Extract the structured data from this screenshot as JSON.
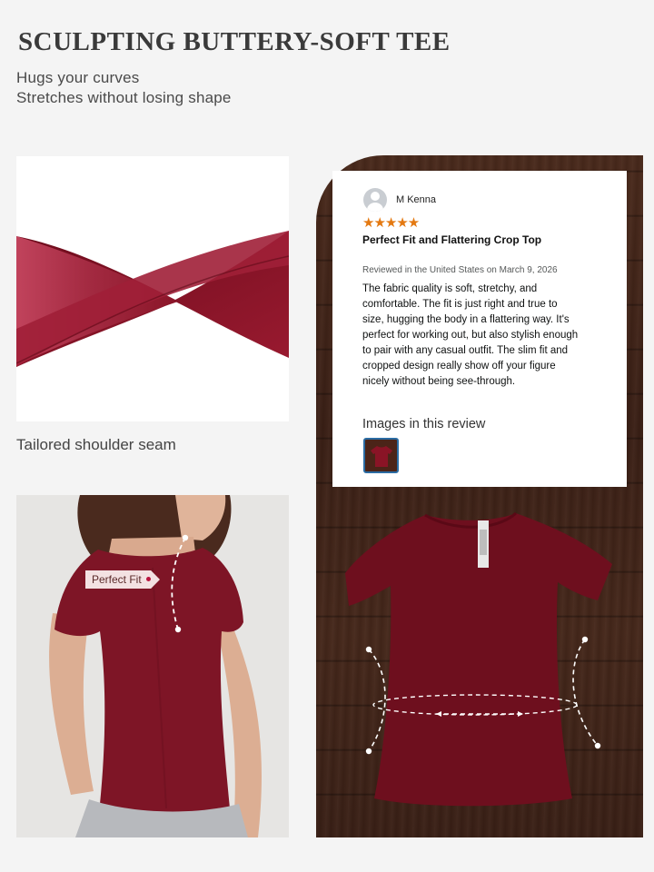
{
  "header": {
    "title": "SCULPTING BUTTERY-SOFT TEE",
    "subtitle_1": "Hugs your curves",
    "subtitle_2": "Stretches without losing shape"
  },
  "fabric_panel": {
    "caption": "Tailored shoulder seam",
    "fabric_color": "#8e1a2a"
  },
  "model_panel": {
    "tag": "Perfect Fit",
    "shirt_color": "#7e1526"
  },
  "review": {
    "reviewer_name": "M Kenna",
    "rating": "★★★★★",
    "title": "Perfect Fit and Flattering Crop Top",
    "meta": "Reviewed in the United States on March 9, 2026",
    "body": "The fabric quality is soft, stretchy, and comfortable. The fit is just right and true to size, hugging the body in a flattering way. It's perfect for working out, but also stylish enough to pair with any casual outfit. The slim fit and cropped design really show off your figure nicely without being see-through.",
    "images_label": "Images in this review",
    "star_color": "#e47911"
  },
  "colors": {
    "background": "#f4f4f4",
    "burgundy": "#7a1424",
    "wood": "#3f2318"
  }
}
